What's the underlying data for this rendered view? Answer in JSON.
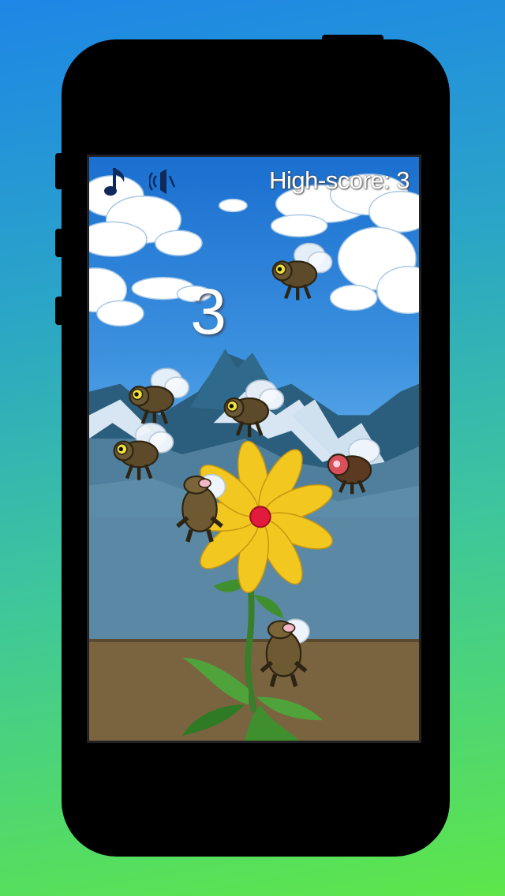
{
  "hud": {
    "music_icon": "music-note-icon",
    "sound_icon": "speaker-muted-icon",
    "highscore_text": "High-score: 3"
  },
  "game": {
    "score": "3"
  },
  "colors": {
    "sky_top": "#1a6fd0",
    "mountains": "#4f7f9c",
    "ground": "#7a6440",
    "flower_petal": "#f2c820",
    "flower_center": "#e21a3b"
  }
}
